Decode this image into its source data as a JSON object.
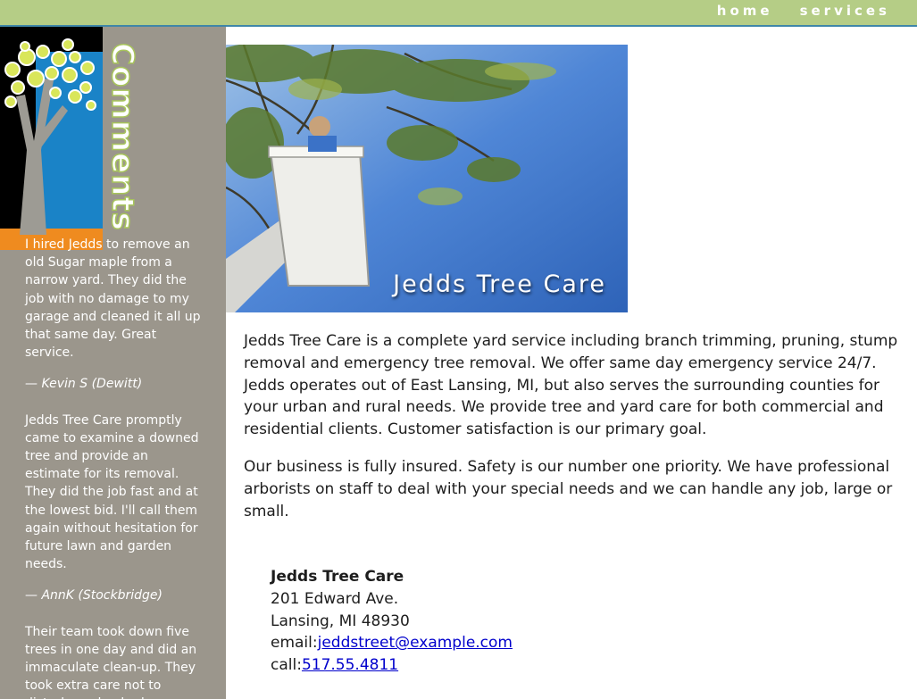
{
  "nav": {
    "items": [
      {
        "label": "home"
      },
      {
        "label": "services"
      }
    ]
  },
  "sidebar": {
    "heading": "Comments",
    "testimonials": [
      {
        "text": "I hired Jedds to remove an old Sugar maple from a narrow yard. They did the job with no damage to my garage and cleaned it all up that same day. Great service.",
        "author": "— Kevin S (Dewitt)"
      },
      {
        "text": "Jedds Tree Care promptly came to examine a downed tree and provide an estimate for its removal. They did the job fast and at the lowest bid. I'll call them again without hesitation for future lawn and garden needs.",
        "author": "— AnnK (Stockbridge)"
      },
      {
        "text": "Their team took down five trees in one day and did an immaculate clean-up. They took extra care not to disturb garden beds.",
        "author": ""
      }
    ]
  },
  "hero": {
    "title": "Jedds Tree Care"
  },
  "intro": {
    "paragraph1": "Jedds Tree Care is a complete yard service including branch trimming, pruning, stump removal and emergency tree removal. We offer same day emergency service 24/7. Jedds operates out of East Lansing, MI, but also serves the surrounding counties for your urban and rural needs. We provide tree and yard care for both commercial and residential clients. Customer satisfaction is our primary goal.",
    "paragraph2": "Our business is fully insured. Safety is our number one priority. We have professional arborists on staff to deal with your special needs and we can handle any job, large or small."
  },
  "contact": {
    "name": "Jedds Tree Care",
    "street": "201 Edward Ave.",
    "city": "Lansing, MI 48930",
    "email_label": "email:",
    "email": "jeddstreet@example.com",
    "call_label": "call:",
    "phone": "517.55.4811"
  },
  "colors": {
    "topbar": "#b5cd86",
    "sidebar": "#9b968c",
    "logo_blue": "#1a83c7",
    "logo_orange": "#ef8b1f",
    "logo_green": "#a8c55c"
  }
}
